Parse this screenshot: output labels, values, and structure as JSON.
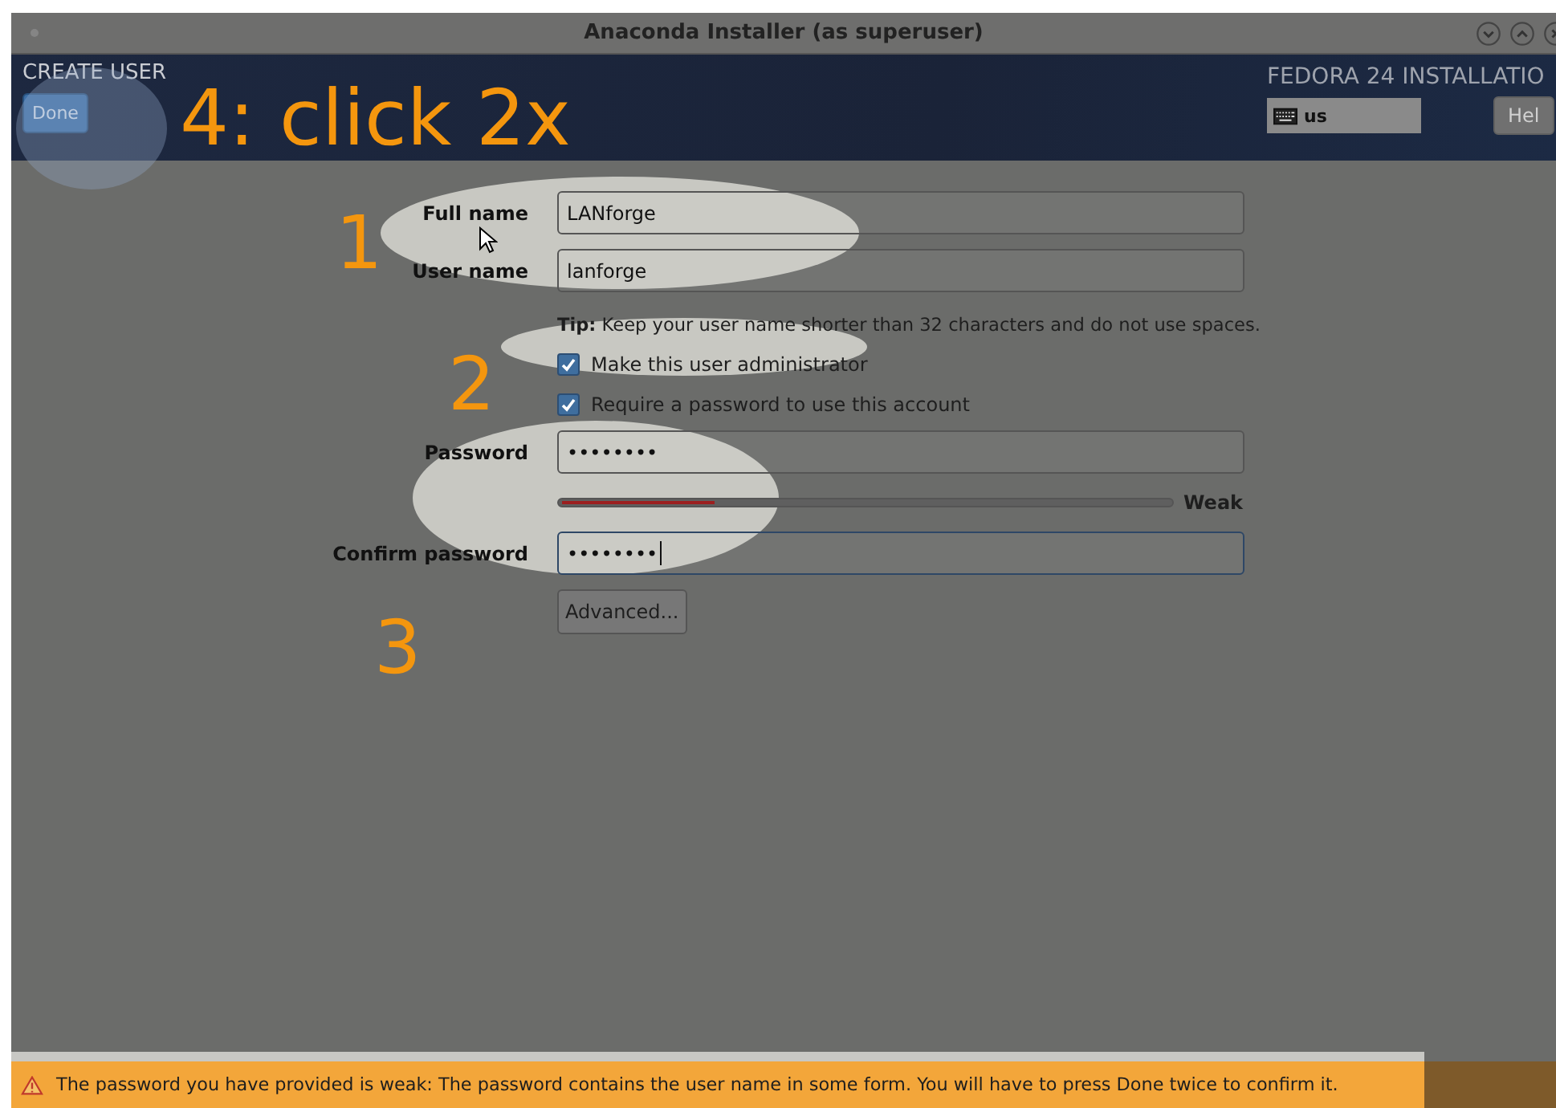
{
  "window": {
    "title": "Anaconda Installer (as superuser)"
  },
  "header": {
    "title": "CREATE USER",
    "done_button": "Done",
    "product": "FEDORA 24 INSTALLATIO",
    "keyboard": "us",
    "help_button": "Hel"
  },
  "form": {
    "fields": [
      {
        "kind": "text",
        "label": "Full name",
        "value": "LANforge",
        "focused": false
      },
      {
        "kind": "text",
        "label": "User name",
        "value": "lanforge",
        "focused": false
      },
      {
        "kind": "tip",
        "text": "**Tip:** Keep your user name shorter than 32 characters and do not use spaces."
      },
      {
        "kind": "checkbox",
        "label": "Make this user administrator",
        "checked": true
      },
      {
        "kind": "checkbox",
        "label": "Require a password to use this account",
        "checked": true
      },
      {
        "kind": "text",
        "label": "Password",
        "value": "••••••••",
        "focused": false
      },
      {
        "kind": "strength",
        "level": 0.25,
        "reading": "Weak"
      },
      {
        "kind": "text",
        "label": "Confirm password",
        "value": "••••••••",
        "focused": true
      },
      {
        "kind": "button",
        "label": "Advanced..."
      }
    ]
  },
  "annotations": [
    {
      "kind": "step",
      "text": "4: click 2x"
    },
    {
      "kind": "step",
      "text": "1"
    },
    {
      "kind": "step",
      "text": "2"
    },
    {
      "kind": "step",
      "text": "3"
    }
  ],
  "status_bar": {
    "message": "The password you have provided is weak: The password contains the user name in some form. You will have to press Done twice to confirm it."
  }
}
